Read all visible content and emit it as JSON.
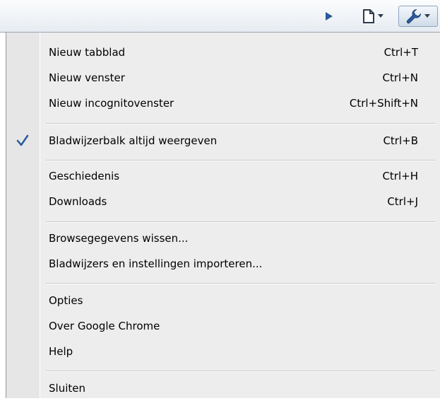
{
  "toolbar": {
    "icons": [
      "play-icon",
      "page-icon",
      "wrench-icon"
    ],
    "accent": "#2b5a9c"
  },
  "menu": {
    "items": [
      {
        "label": "Nieuw tabblad",
        "shortcut": "Ctrl+T"
      },
      {
        "label": "Nieuw venster",
        "shortcut": "Ctrl+N"
      },
      {
        "label": "Nieuw incognitovenster",
        "shortcut": "Ctrl+Shift+N"
      },
      {
        "label": "Bladwijzerbalk altijd weergeven",
        "shortcut": "Ctrl+B",
        "checked": true
      },
      {
        "label": "Geschiedenis",
        "shortcut": "Ctrl+H"
      },
      {
        "label": "Downloads",
        "shortcut": "Ctrl+J"
      },
      {
        "label": "Browsegegevens wissen...",
        "shortcut": ""
      },
      {
        "label": "Bladwijzers en instellingen importeren...",
        "shortcut": ""
      },
      {
        "label": "Opties",
        "shortcut": ""
      },
      {
        "label": "Over Google Chrome",
        "shortcut": ""
      },
      {
        "label": "Help",
        "shortcut": ""
      },
      {
        "label": "Sluiten",
        "shortcut": ""
      }
    ]
  }
}
